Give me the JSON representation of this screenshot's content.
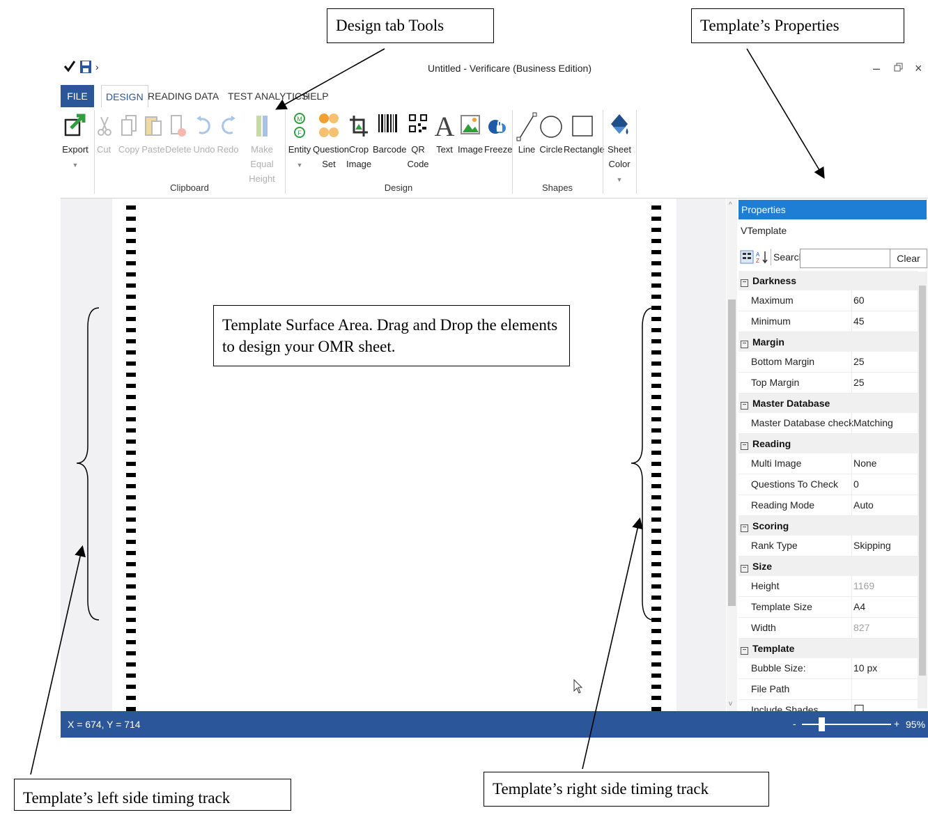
{
  "window": {
    "title": "Untitled - Verificare (Business Edition)",
    "quick_access": [
      "check-icon",
      "save-icon",
      "chevron-right-icon"
    ],
    "controls": {
      "minimize": "–",
      "restore": "🗗",
      "close": "×"
    }
  },
  "menu_tabs": [
    "FILE",
    "DESIGN",
    "READING",
    "DATA",
    "TEST ANALYTICS",
    "HELP"
  ],
  "ribbon": {
    "export": {
      "label": "Export",
      "icon": "export-icon"
    },
    "clipboard": {
      "group_label": "Clipboard",
      "items": [
        {
          "label": "Cut",
          "icon": "scissors-icon"
        },
        {
          "label": "Copy",
          "icon": "copy-icon"
        },
        {
          "label": "Paste",
          "icon": "paste-icon"
        },
        {
          "label": "Delete",
          "icon": "delete-icon"
        },
        {
          "label": "Undo",
          "icon": "undo-icon"
        },
        {
          "label": "Redo",
          "icon": "redo-icon"
        },
        {
          "label": "Make Equal",
          "label2": "Height",
          "icon": "equal-height-icon"
        }
      ]
    },
    "design": {
      "group_label": "Design",
      "items": [
        {
          "label": "Entity",
          "icon": "entity-icon"
        },
        {
          "label": "Question",
          "label2": "Set",
          "icon": "question-set-icon"
        },
        {
          "label": "Crop",
          "label2": "Image",
          "icon": "crop-icon"
        },
        {
          "label": "Barcode",
          "icon": "barcode-icon"
        },
        {
          "label": "QR",
          "label2": "Code",
          "icon": "qr-code-icon"
        },
        {
          "label": "Text",
          "icon": "text-icon"
        },
        {
          "label": "Image",
          "icon": "image-icon"
        },
        {
          "label": "Freeze",
          "icon": "freeze-icon"
        }
      ]
    },
    "shapes": {
      "group_label": "Shapes",
      "items": [
        {
          "label": "Line",
          "icon": "line-icon"
        },
        {
          "label": "Circle",
          "icon": "circle-icon"
        },
        {
          "label": "Rectangle",
          "icon": "rectangle-icon"
        }
      ]
    },
    "sheet_color": {
      "label": "Sheet",
      "label2": "Color",
      "icon": "sheet-color-icon"
    }
  },
  "properties": {
    "header": "Properties",
    "object": "VTemplate",
    "search_label": "Search:",
    "clear_label": "Clear",
    "categories": [
      {
        "name": "Darkness",
        "rows": [
          {
            "key": "Maximum",
            "value": "60"
          },
          {
            "key": "Minimum",
            "value": "45"
          }
        ]
      },
      {
        "name": "Margin",
        "rows": [
          {
            "key": "Bottom Margin",
            "value": "25"
          },
          {
            "key": "Top Margin",
            "value": "25"
          }
        ]
      },
      {
        "name": "Master Database",
        "rows": [
          {
            "key": "Master Database check",
            "value": "Matching"
          }
        ]
      },
      {
        "name": "Reading",
        "rows": [
          {
            "key": "Multi Image",
            "value": "None"
          },
          {
            "key": "Questions To Check",
            "value": "0"
          },
          {
            "key": "Reading Mode",
            "value": "Auto"
          }
        ]
      },
      {
        "name": "Scoring",
        "rows": [
          {
            "key": "Rank Type",
            "value": "Skipping"
          }
        ]
      },
      {
        "name": "Size",
        "rows": [
          {
            "key": "Height",
            "value": "1169"
          },
          {
            "key": "Template Size",
            "value": "A4"
          },
          {
            "key": "Width",
            "value": "827"
          }
        ]
      },
      {
        "name": "Template",
        "rows": [
          {
            "key": "Bubble Size:",
            "value": "10 px"
          },
          {
            "key": "File Path",
            "value": ""
          },
          {
            "key": "Include Shades",
            "value": "☐"
          }
        ]
      }
    ]
  },
  "status": {
    "coords": "X = 674, Y = 714",
    "zoom_minus": "-",
    "zoom_plus": "+",
    "zoom": "95%"
  },
  "annotations": {
    "design_tab_tools": "Design tab Tools",
    "template_properties": "Template’s Properties",
    "surface_area": "Template Surface Area. Drag and Drop the elements to design your OMR sheet.",
    "left_track": "Template’s left side timing track",
    "right_track": "Template’s right side timing track"
  }
}
